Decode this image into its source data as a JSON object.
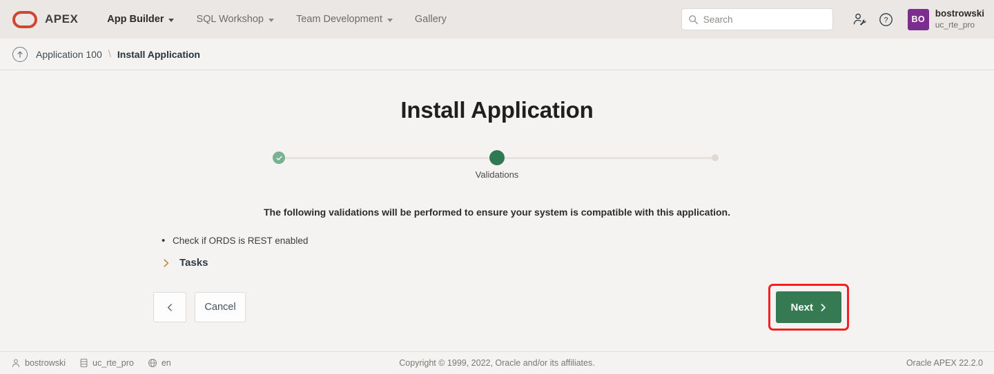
{
  "header": {
    "brand": "APEX",
    "logo_color": "#cf4632",
    "nav": [
      {
        "label": "App Builder",
        "has_caret": true,
        "active": true
      },
      {
        "label": "SQL Workshop",
        "has_caret": true,
        "active": false
      },
      {
        "label": "Team Development",
        "has_caret": true,
        "active": false
      },
      {
        "label": "Gallery",
        "has_caret": false,
        "active": false
      }
    ],
    "search": {
      "placeholder": "Search",
      "value": ""
    },
    "icons": [
      "account-admin-icon",
      "help-icon"
    ],
    "user": {
      "initials": "BO",
      "name": "bostrowski",
      "workspace": "uc_rte_pro",
      "avatar_color": "#7b2e8e"
    }
  },
  "breadcrumb": {
    "up_icon": "arrow-up-circle-icon",
    "parent": "Application 100",
    "separator": "\\",
    "current": "Install Application"
  },
  "main": {
    "title": "Install Application",
    "steps": [
      {
        "label": "",
        "state": "done"
      },
      {
        "label": "Validations",
        "state": "current"
      },
      {
        "label": "",
        "state": "todo"
      }
    ],
    "lead_text": "The following validations will be performed to ensure your system is compatible with this application.",
    "validations": [
      "Check if ORDS is REST enabled"
    ],
    "tasks": {
      "label": "Tasks",
      "expanded": false,
      "icon": "chevron-right-icon"
    },
    "buttons": {
      "previous": {
        "label": "",
        "icon": "chevron-left-icon"
      },
      "cancel": {
        "label": "Cancel"
      },
      "next": {
        "label": "Next",
        "icon": "chevron-right-icon",
        "color": "#357a52",
        "highlighted": true,
        "highlight_color": "#f51d1d"
      }
    }
  },
  "footer": {
    "user": "bostrowski",
    "schema": "uc_rte_pro",
    "language": "en",
    "copyright": "Copyright © 1999, 2022, Oracle and/or its affiliates.",
    "version": "Oracle APEX 22.2.0"
  }
}
